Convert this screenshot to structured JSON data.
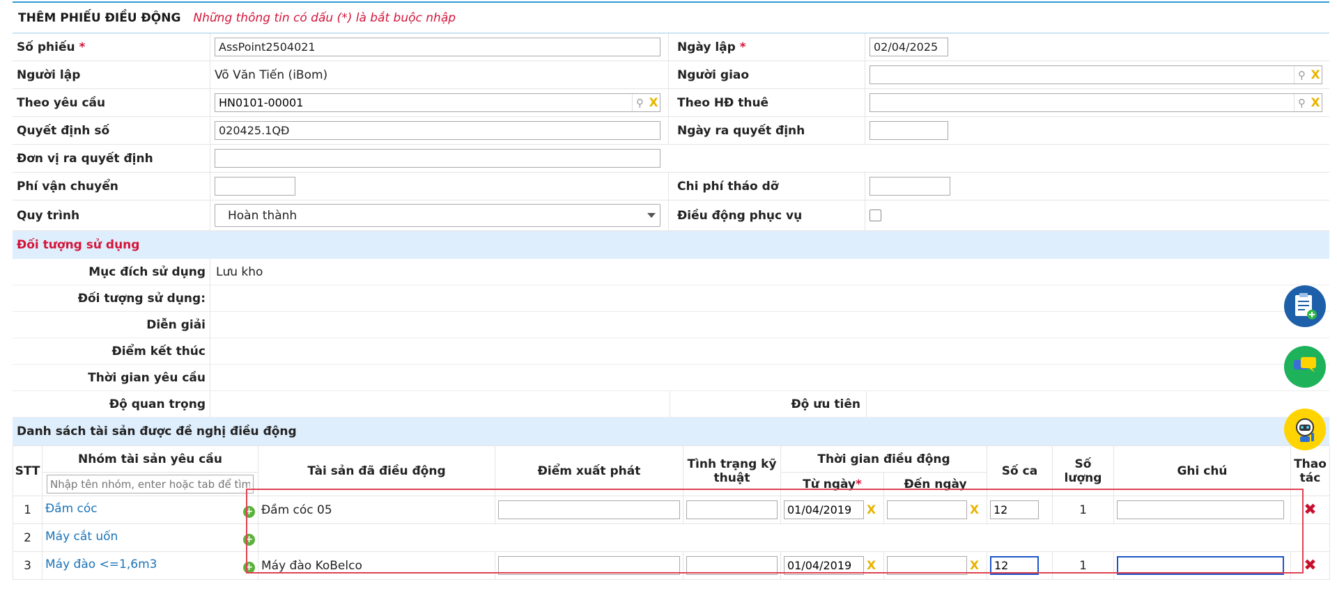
{
  "header": {
    "title": "THÊM PHIẾU ĐIỀU ĐỘNG",
    "note": "Những thông tin có dấu (*) là bắt buộc nhập"
  },
  "form": {
    "so_phieu_label": "Số phiếu",
    "so_phieu_value": "AssPoint2504021",
    "ngay_lap_label": "Ngày lập",
    "ngay_lap_value": "02/04/2025",
    "nguoi_lap_label": "Người lập",
    "nguoi_lap_value": "Võ Văn Tiến (iBom)",
    "nguoi_giao_label": "Người giao",
    "nguoi_giao_value": "",
    "theo_yeu_cau_label": "Theo yêu cầu",
    "theo_yeu_cau_value": "HN0101-00001",
    "theo_hd_thue_label": "Theo HĐ thuê",
    "theo_hd_thue_value": "",
    "quyet_dinh_so_label": "Quyết định số",
    "quyet_dinh_so_value": "020425.1QĐ",
    "ngay_ra_qd_label": "Ngày ra quyết định",
    "ngay_ra_qd_value": "",
    "don_vi_qd_label": "Đơn vị ra quyết định",
    "don_vi_qd_value": "",
    "phi_van_chuyen_label": "Phí vận chuyển",
    "phi_van_chuyen_value": "",
    "chi_phi_thao_do_label": "Chi phí tháo dỡ",
    "chi_phi_thao_do_value": "",
    "quy_trinh_label": "Quy trình",
    "quy_trinh_value": "Hoàn thành",
    "dieu_dong_phuc_vu_label": "Điều động phục vụ",
    "required_mark": "*"
  },
  "usage": {
    "section_title": "Đối tượng sử dụng",
    "muc_dich_label": "Mục đích sử dụng",
    "muc_dich_value": "Lưu kho",
    "doi_tuong_label": "Đối tượng sử dụng:",
    "dien_giai_label": "Diễn giải",
    "diem_ket_thuc_label": "Điểm kết thúc",
    "thoi_gian_yc_label": "Thời gian yêu cầu",
    "do_quan_trong_label": "Độ quan trọng",
    "do_uu_tien_label": "Độ ưu tiên"
  },
  "assets": {
    "section_title": "Danh sách tài sản được đề nghị điều động",
    "headers": {
      "stt": "STT",
      "nhom": "Nhóm tài sản yêu cầu",
      "tai_san": "Tài sản đã điều động",
      "diem_xuat_phat": "Điểm xuất phát",
      "tinh_trang": "Tình trạng kỹ thuật",
      "thoi_gian": "Thời gian điều động",
      "tu_ngay": "Từ ngày",
      "den_ngay": "Đến ngày",
      "so_ca": "Số ca",
      "so_luong": "Số lượng",
      "ghi_chu": "Ghi chú",
      "thao_tac": "Thao tác"
    },
    "filter_placeholder": "Nhập tên nhóm, enter hoặc tab để tìm!",
    "rows": [
      {
        "stt": "1",
        "group": "Đầm cóc",
        "asset": "Đầm cóc 05",
        "tu_ngay": "01/04/2019",
        "so_ca": "12",
        "so_luong": "1"
      },
      {
        "stt": "2",
        "group": "Máy cắt uốn",
        "asset": "",
        "tu_ngay": "",
        "so_ca": "",
        "so_luong": ""
      },
      {
        "stt": "3",
        "group": "Máy đào <=1,6m3",
        "asset": "Máy đào KoBelco",
        "tu_ngay": "01/04/2019",
        "so_ca": "12",
        "so_luong": "1"
      }
    ]
  },
  "colors": {
    "accent": "#2a9bd4",
    "required": "#d4143a",
    "section_bg": "#dfeefc",
    "link": "#1a73b8"
  }
}
